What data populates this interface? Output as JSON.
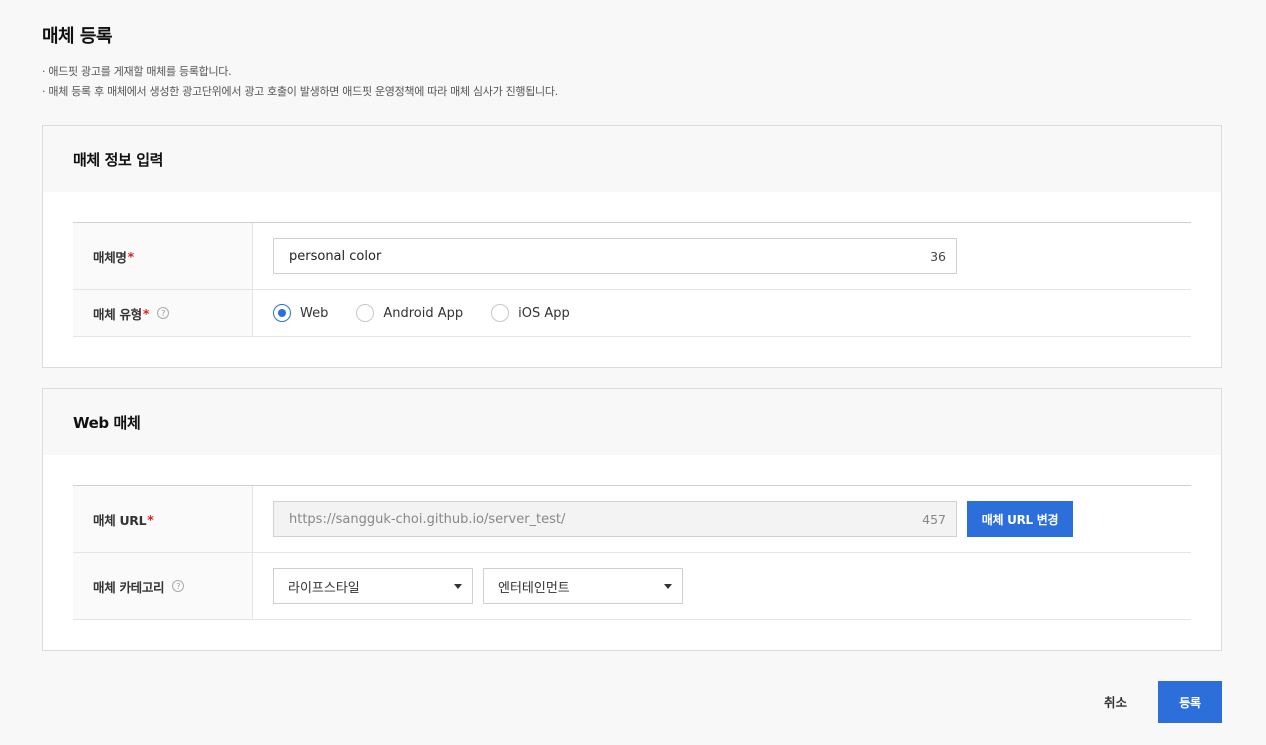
{
  "page": {
    "title": "매체 등록",
    "desc_lines": [
      "· 애드핏 광고를 게재할 매체를 등록합니다.",
      "· 매체 등록 후 매체에서 생성한 광고단위에서 광고 호출이 발생하면 애드핏 운영정책에 따라 매체 심사가 진행됩니다."
    ]
  },
  "info_section": {
    "title": "매체 정보 입력",
    "name_label": "매체명",
    "name_value": "personal color",
    "name_counter": "36",
    "type_label": "매체 유형",
    "type_options": [
      "Web",
      "Android App",
      "iOS App"
    ],
    "type_selected": "Web"
  },
  "web_section": {
    "title": "Web 매체",
    "url_label": "매체 URL",
    "url_value": "https://sangguk-choi.github.io/server_test/",
    "url_counter": "457",
    "url_button": "매체 URL 변경",
    "category_label": "매체 카테고리",
    "category_primary": "라이프스타일",
    "category_secondary": "엔터테인먼트"
  },
  "footer": {
    "cancel_label": "취소",
    "submit_label": "등록"
  },
  "colors": {
    "accent": "#2c6fdb",
    "required": "#e02020"
  },
  "required_mark": "*",
  "help_glyph": "?"
}
